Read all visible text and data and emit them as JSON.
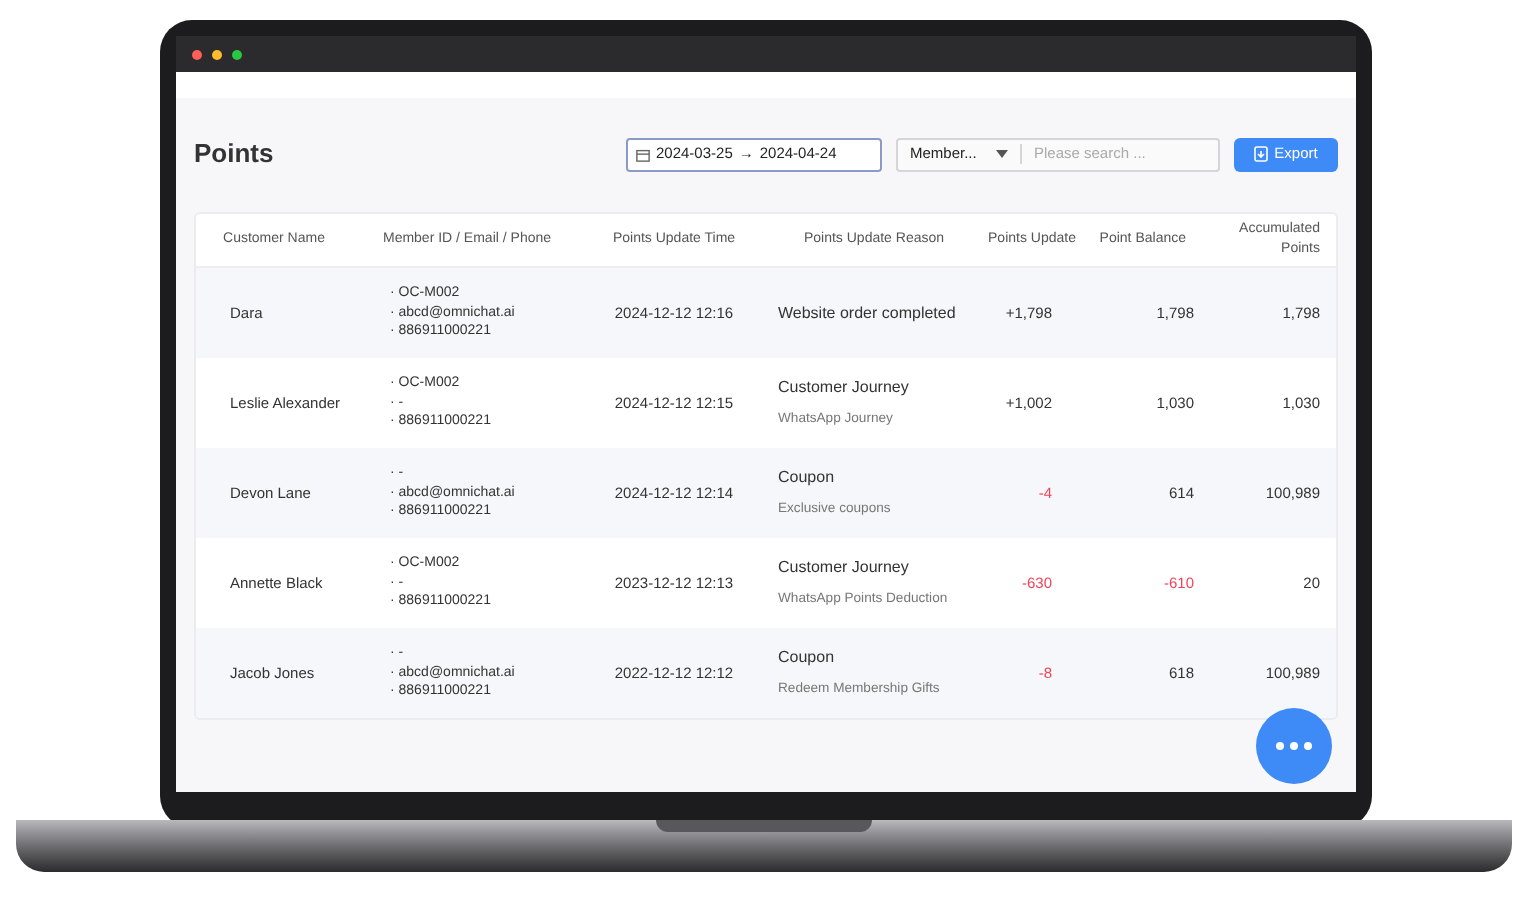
{
  "page": {
    "title": "Points"
  },
  "date_range": {
    "start": "2024-03-25",
    "arrow": "→",
    "end": "2024-04-24"
  },
  "search": {
    "filter": "Member...",
    "placeholder": "Please search ..."
  },
  "export_button": "Export",
  "table": {
    "columns": [
      "Customer Name",
      "Member ID / Email / Phone",
      "Points Update Time",
      "Points Update Reason",
      "Points Update",
      "Point Balance",
      "Accumulated Points"
    ],
    "rows": [
      {
        "name": "Dara",
        "member": [
          "· OC-M002",
          "· abcd@omnichat.ai",
          "· 886911000221"
        ],
        "time": "2024-12-12 12:16",
        "reason": "Website order completed",
        "update": "+1,798",
        "update_negative": false,
        "balance": "1,798",
        "balance_negative": false,
        "accumulated": "1,798"
      },
      {
        "name": "Leslie Alexander",
        "member": [
          "· OC-M002",
          "· -",
          "· 886911000221"
        ],
        "time": "2024-12-12 12:15",
        "reason": "Customer Journey",
        "detail": "WhatsApp Journey",
        "update": "+1,002",
        "update_negative": false,
        "balance": "1,030",
        "balance_negative": false,
        "accumulated": "1,030"
      },
      {
        "name": "Devon Lane",
        "member": [
          "· -",
          "· abcd@omnichat.ai",
          "· 886911000221"
        ],
        "time": "2024-12-12 12:14",
        "reason": "Coupon",
        "detail": "Exclusive coupons",
        "update": "-4",
        "update_negative": true,
        "balance": "614",
        "balance_negative": false,
        "accumulated": "100,989"
      },
      {
        "name": "Annette Black",
        "member": [
          "· OC-M002",
          "· -",
          "· 886911000221"
        ],
        "time": "2023-12-12 12:13",
        "reason": "Customer Journey",
        "detail": "WhatsApp Points Deduction",
        "update": "-630",
        "update_negative": true,
        "balance": "-610",
        "balance_negative": true,
        "accumulated": "20"
      },
      {
        "name": "Jacob Jones",
        "member": [
          "· -",
          "· abcd@omnichat.ai",
          "· 886911000221"
        ],
        "time": "2022-12-12 12:12",
        "reason": "Coupon",
        "detail": "Redeem Membership Gifts",
        "update": "-8",
        "update_negative": true,
        "balance": "618",
        "balance_negative": false,
        "accumulated": "100,989"
      }
    ]
  }
}
